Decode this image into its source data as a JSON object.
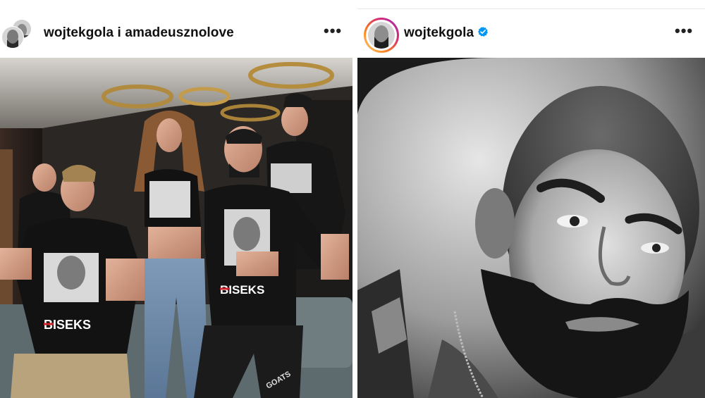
{
  "left_post": {
    "username": "wojtekgola i amadeusznolove",
    "more_label": "•••",
    "shirt_text_left": "BISEKS",
    "shirt_text_right": "BISEKS",
    "pants_text": "GOATS"
  },
  "right_post": {
    "username": "wojtekgola",
    "more_label": "•••",
    "verified": true
  },
  "colors": {
    "verified_blue": "#0095f6",
    "story_ring": [
      "#feda75",
      "#fa7e1e",
      "#d62976",
      "#962fbf"
    ],
    "shirt_red": "#d0222a"
  }
}
